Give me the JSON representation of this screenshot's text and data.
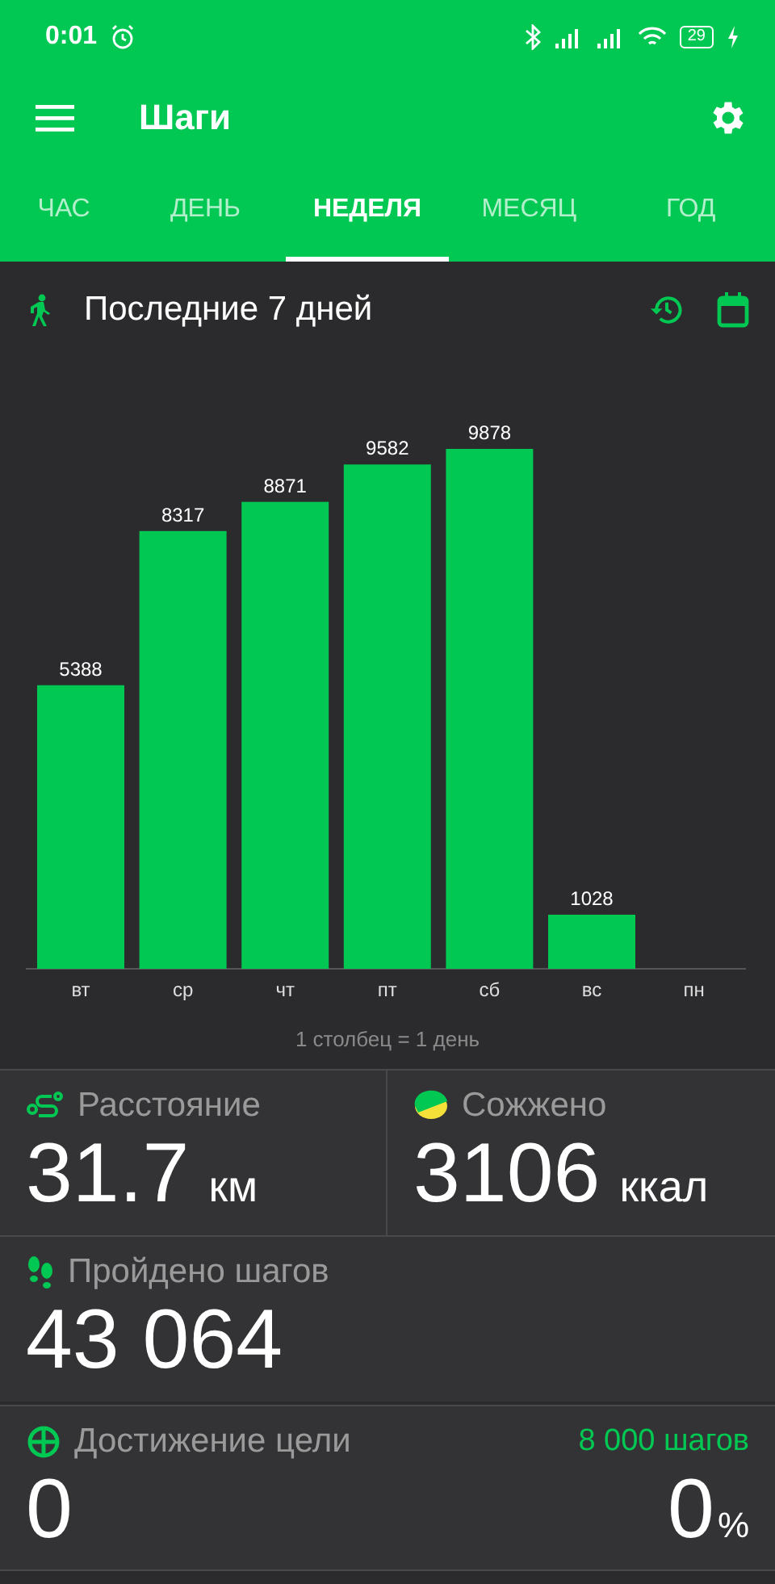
{
  "status_bar": {
    "time": "0:01",
    "battery": "29"
  },
  "app_bar": {
    "title": "Шаги"
  },
  "tabs": [
    {
      "label": "ЧАС",
      "selected": false
    },
    {
      "label": "ДЕНЬ",
      "selected": false
    },
    {
      "label": "НЕДЕЛЯ",
      "selected": true
    },
    {
      "label": "МЕСЯЦ",
      "selected": false
    },
    {
      "label": "ГОД",
      "selected": false
    }
  ],
  "period": {
    "title": "Последние 7 дней"
  },
  "chart_data": {
    "type": "bar",
    "categories": [
      "вт",
      "ср",
      "чт",
      "пт",
      "сб",
      "вс",
      "пн"
    ],
    "series": [
      {
        "color": "#00c853",
        "values": [
          5388,
          8317,
          8871,
          9582,
          9878,
          1028,
          null
        ]
      }
    ],
    "data_labels": true
  },
  "chart_caption": "1 столбец = 1 день",
  "stats": [
    {
      "kind": "distance",
      "label": "Расстояние",
      "value": "31.7",
      "unit": "км"
    },
    {
      "kind": "calories",
      "label": "Сожжено",
      "value": "3106",
      "unit": "ккал"
    },
    {
      "kind": "steps",
      "label": "Пройдено шагов",
      "value": "43 064"
    },
    {
      "kind": "goal",
      "label": "Достижение цели",
      "target": "8 000 шагов",
      "value": "0",
      "percent": "0",
      "unit": "%"
    }
  ]
}
